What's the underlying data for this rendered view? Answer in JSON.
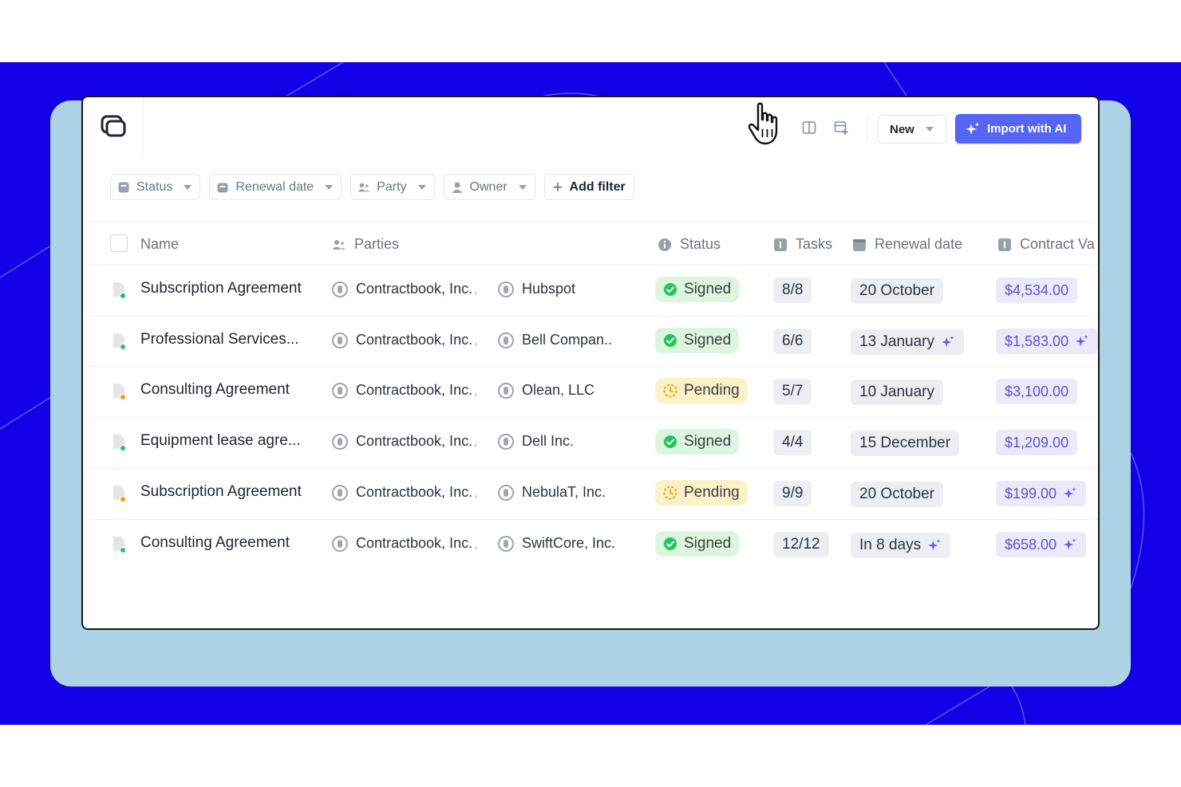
{
  "topbar": {
    "new_label": "New",
    "import_label": "Import with AI"
  },
  "filters": [
    {
      "label": "Status",
      "icon": "status-icon"
    },
    {
      "label": "Renewal date",
      "icon": "calendar-icon"
    },
    {
      "label": "Party",
      "icon": "people-icon"
    },
    {
      "label": "Owner",
      "icon": "user-icon"
    }
  ],
  "add_filter_label": "Add filter",
  "columns": {
    "name": "Name",
    "parties": "Parties",
    "status": "Status",
    "tasks": "Tasks",
    "renewal": "Renewal date",
    "value": "Contract Va"
  },
  "rows": [
    {
      "name": "Subscription Agreement",
      "party1": "Contractbook, Inc.",
      "party2": "Hubspot",
      "status": "Signed",
      "tasks": "8/8",
      "renewal": "20 October",
      "renewal_ai": false,
      "value": "$4,534.00",
      "value_ai": false,
      "doc_dot": "#22c55e"
    },
    {
      "name": "Professional Services...",
      "party1": "Contractbook, Inc.",
      "party2": "Bell Compan..",
      "status": "Signed",
      "tasks": "6/6",
      "renewal": "13 January",
      "renewal_ai": true,
      "value": "$1,583.00",
      "value_ai": true,
      "doc_dot": "#22c55e"
    },
    {
      "name": "Consulting Agreement",
      "party1": "Contractbook, Inc.",
      "party2": "Olean, LLC",
      "status": "Pending",
      "tasks": "5/7",
      "renewal": "10 January",
      "renewal_ai": false,
      "value": "$3,100.00",
      "value_ai": false,
      "doc_dot": "#f59e0b"
    },
    {
      "name": "Equipment lease agre...",
      "party1": "Contractbook, Inc.",
      "party2": "Dell Inc.",
      "status": "Signed",
      "tasks": "4/4",
      "renewal": "15 December",
      "renewal_ai": false,
      "value": "$1,209.00",
      "value_ai": false,
      "doc_dot": "#22c55e"
    },
    {
      "name": "Subscription Agreement",
      "party1": "Contractbook, Inc.",
      "party2": "NebulaT, Inc.",
      "status": "Pending",
      "tasks": "9/9",
      "renewal": "20 October",
      "renewal_ai": false,
      "value": "$199.00",
      "value_ai": true,
      "doc_dot": "#f59e0b"
    },
    {
      "name": "Consulting Agreement",
      "party1": "Contractbook, Inc.",
      "party2": "SwiftCore, Inc.",
      "status": "Signed",
      "tasks": "12/12",
      "renewal": "In 8 days",
      "renewal_ai": true,
      "value": "$658.00",
      "value_ai": true,
      "doc_dot": "#22c55e"
    }
  ],
  "colors": {
    "background": "#1400e6",
    "frame": "#acd3e5",
    "accent": "#5566f5",
    "signed_bg": "#dcf5de",
    "pending_bg": "#fdf1c8",
    "money_text": "#5b55d6"
  }
}
